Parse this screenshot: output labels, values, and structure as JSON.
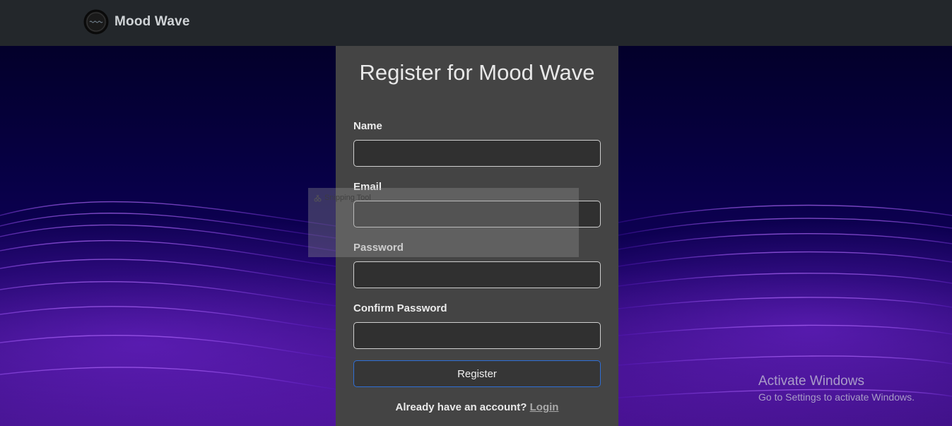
{
  "navbar": {
    "brand_name": "Mood Wave",
    "logo_icon": "wave-logo-icon"
  },
  "form": {
    "title": "Register for Mood Wave",
    "fields": [
      {
        "label": "Name",
        "value": "",
        "placeholder": ""
      },
      {
        "label": "Email",
        "value": "",
        "placeholder": ""
      },
      {
        "label": "Password",
        "value": "",
        "placeholder": ""
      },
      {
        "label": "Confirm Password",
        "value": "",
        "placeholder": ""
      }
    ],
    "submit_label": "Register",
    "login_prompt": "Already have an account?",
    "login_link": "Login"
  },
  "overlay": {
    "snipping_tool_label": "Snipping Tool"
  },
  "watermark": {
    "title": "Activate Windows",
    "subtitle": "Go to Settings to activate Windows."
  },
  "colors": {
    "navbar_bg": "#23272b",
    "card_bg": "#444444",
    "input_bg": "#303030",
    "button_border": "#2f6fd6",
    "wave_purple": "#7a2fe0"
  }
}
